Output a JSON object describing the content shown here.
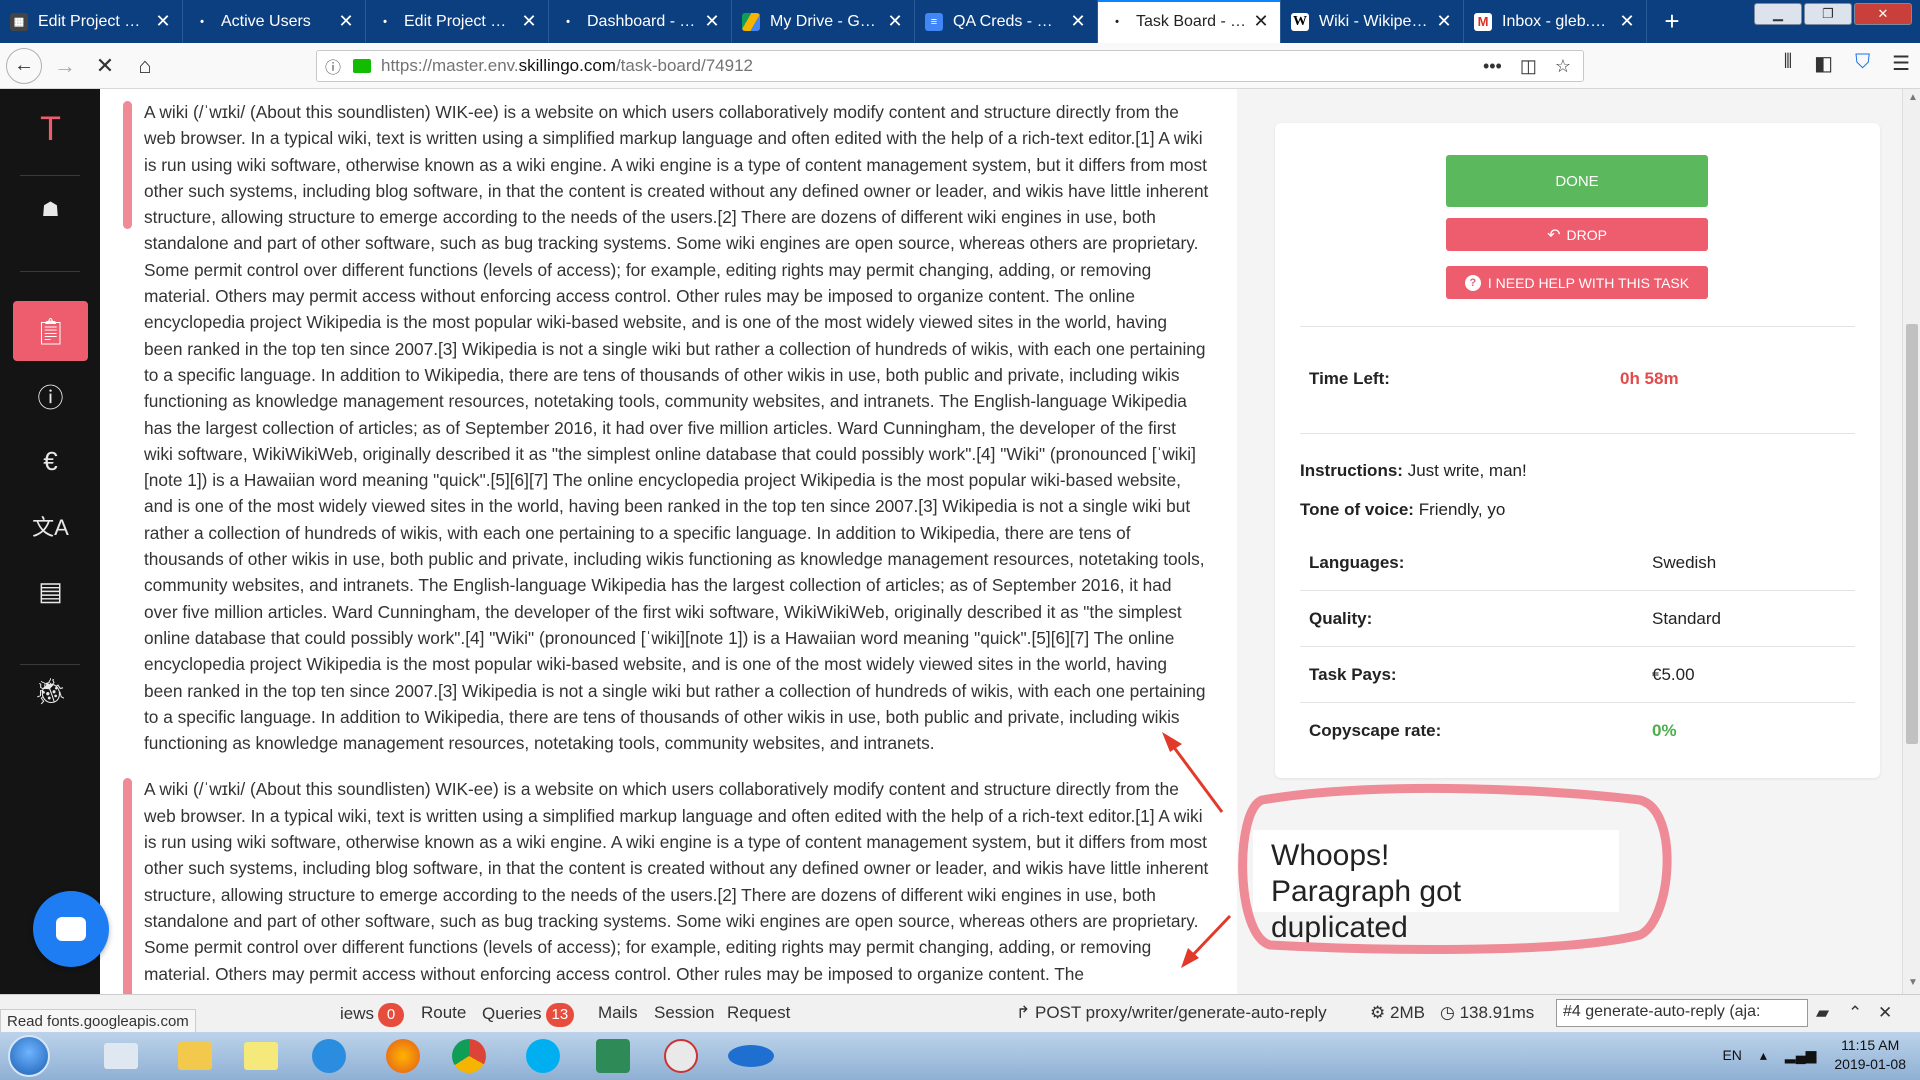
{
  "browser": {
    "tabs": [
      {
        "title": "Edit Project Cont",
        "active": false,
        "favicon": "page-icon"
      },
      {
        "title": "Active Users",
        "active": false,
        "favicon": "dot-icon"
      },
      {
        "title": "Edit Project Cont",
        "active": false,
        "favicon": "dot-icon"
      },
      {
        "title": "Dashboard - Topi",
        "active": false,
        "favicon": "dot-icon"
      },
      {
        "title": "My Drive - Googl",
        "active": false,
        "favicon": "drive-icon"
      },
      {
        "title": "QA Creds - Goog",
        "active": false,
        "favicon": "docs-icon"
      },
      {
        "title": "Task Board - Topi",
        "active": true,
        "favicon": "dot-icon"
      },
      {
        "title": "Wiki - Wikipedia",
        "active": false,
        "favicon": "wikipedia-icon"
      },
      {
        "title": "Inbox - gleb.klim",
        "active": false,
        "favicon": "gmail-icon"
      }
    ],
    "url_prefix": "https://master.env.",
    "url_domain": "skillingo.com",
    "url_path": "/task-board/74912"
  },
  "sidebar": {
    "logo": "T",
    "items": [
      "avatar-icon",
      "clipboard-icon",
      "info-icon",
      "euro-icon",
      "translate-icon",
      "document-icon",
      "bug-icon"
    ]
  },
  "article": {
    "paragraphs": [
      "A wiki (/ˈwɪki/ (About this soundlisten) WIK-ee) is a website on which users collaboratively modify content and structure directly from the web browser. In a typical wiki, text is written using a simplified markup language and often edited with the help of a rich-text editor.[1] A wiki is run using wiki software, otherwise known as a wiki engine. A wiki engine is a type of content management system, but it differs from most other such systems, including blog software, in that the content is created without any defined owner or leader, and wikis have little inherent structure, allowing structure to emerge according to the needs of the users.[2] There are dozens of different wiki engines in use, both standalone and part of other software, such as bug tracking systems. Some wiki engines are open source, whereas others are proprietary. Some permit control over different functions (levels of access); for example, editing rights may permit changing, adding, or removing material. Others may permit access without enforcing access control. Other rules may be imposed to organize content. The online encyclopedia project Wikipedia is the most popular wiki-based website, and is one of the most widely viewed sites in the world, having been ranked in the top ten since 2007.[3] Wikipedia is not a single wiki but rather a collection of hundreds of wikis, with each one pertaining to a specific language. In addition to Wikipedia, there are tens of thousands of other wikis in use, both public and private, including wikis functioning as knowledge management resources, notetaking tools, community websites, and intranets. The English-language Wikipedia has the largest collection of articles; as of September 2016, it had over five million articles. Ward Cunningham, the developer of the first wiki software, WikiWikiWeb, originally described it as \"the simplest online database that could possibly work\".[4] \"Wiki\" (pronounced [ˈwiki][note 1]) is a Hawaiian word meaning \"quick\".[5][6][7] The online encyclopedia project Wikipedia is the most popular wiki-based website, and is one of the most widely viewed sites in the world, having been ranked in the top ten since 2007.[3] Wikipedia is not a single wiki but rather a collection of hundreds of wikis, with each one pertaining to a specific language. In addition to Wikipedia, there are tens of thousands of other wikis in use, both public and private, including wikis functioning as knowledge management resources, notetaking tools, community websites, and intranets. The English-language Wikipedia has the largest collection of articles; as of September 2016, it had over five million articles. Ward Cunningham, the developer of the first wiki software, WikiWikiWeb, originally described it as \"the simplest online database that could possibly work\".[4] \"Wiki\" (pronounced [ˈwiki][note 1]) is a Hawaiian word meaning \"quick\".[5][6][7] The online encyclopedia project Wikipedia is the most popular wiki-based website, and is one of the most widely viewed sites in the world, having been ranked in the top ten since 2007.[3] Wikipedia is not a single wiki but rather a collection of hundreds of wikis, with each one pertaining to a specific language. In addition to Wikipedia, there are tens of thousands of other wikis in use, both public and private, including wikis functioning as knowledge management resources, notetaking tools, community websites, and intranets.",
      "A wiki (/ˈwɪki/ (About this soundlisten) WIK-ee) is a website on which users collaboratively modify content and structure directly from the web browser. In a typical wiki, text is written using a simplified markup language and often edited with the help of a rich-text editor.[1] A wiki is run using wiki software, otherwise known as a wiki engine. A wiki engine is a type of content management system, but it differs from most other such systems, including blog software, in that the content is created without any defined owner or leader, and wikis have little inherent structure, allowing structure to emerge according to the needs of the users.[2] There are dozens of different wiki engines in use, both standalone and part of other software, such as bug tracking systems. Some wiki engines are open source, whereas others are proprietary. Some permit control over different functions (levels of access); for example, editing rights may permit changing, adding, or removing material. Others may permit access without enforcing access control. Other rules may be imposed to organize content. The"
    ]
  },
  "task": {
    "done_label": "DONE",
    "drop_label": "DROP",
    "help_label": "I NEED HELP WITH THIS TASK",
    "time_left_label": "Time Left:",
    "time_left_value": "0h 58m",
    "instructions_label": "Instructions:",
    "instructions_value": "Just write, man!",
    "tone_label": "Tone of voice:",
    "tone_value": "Friendly, yo",
    "languages_label": "Languages:",
    "languages_value": "Swedish",
    "quality_label": "Quality:",
    "quality_value": "Standard",
    "pays_label": "Task Pays:",
    "pays_value": "€5.00",
    "copyscape_label": "Copyscape rate:",
    "copyscape_value": "0%"
  },
  "annotation": {
    "line1": "Whoops!",
    "line2": "Paragraph got duplicated"
  },
  "debugbar": {
    "status_message": "Read fonts.googleapis.com",
    "tabs": [
      {
        "label": "iews",
        "badge": "0"
      },
      {
        "label": "Route",
        "badge": ""
      },
      {
        "label": "Queries",
        "badge": "13"
      },
      {
        "label": "Mails",
        "badge": ""
      },
      {
        "label": "Session",
        "badge": ""
      },
      {
        "label": "Request",
        "badge": ""
      }
    ],
    "request": "POST proxy/writer/generate-auto-reply",
    "memory": "2MB",
    "duration": "138.91ms",
    "select_value": "#4 generate-auto-reply (aja:"
  },
  "taskbar": {
    "language": "EN",
    "time": "11:15 AM",
    "date": "2019-01-08"
  },
  "colors": {
    "done": "#5cb85c",
    "drop": "#ee5d6e",
    "time_left": "#e04c4c",
    "copyscape": "#4cae4c",
    "annotation": "#ee8b96"
  }
}
